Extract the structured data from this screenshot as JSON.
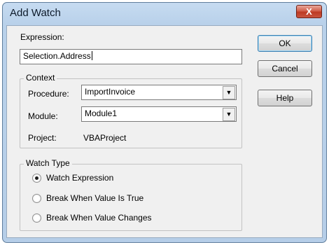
{
  "window": {
    "title": "Add Watch",
    "close_glyph": "X"
  },
  "expression": {
    "label": "Expression:",
    "value": "Selection.Address"
  },
  "context": {
    "legend": "Context",
    "procedure": {
      "label": "Procedure:",
      "value": "ImportInvoice"
    },
    "module": {
      "label": "Module:",
      "value": "Module1"
    },
    "project": {
      "label": "Project:",
      "value": "VBAProject"
    }
  },
  "watch_type": {
    "legend": "Watch Type",
    "options": [
      {
        "label": "Watch Expression",
        "selected": true
      },
      {
        "label": "Break When Value Is True",
        "selected": false
      },
      {
        "label": "Break When Value Changes",
        "selected": false
      }
    ]
  },
  "buttons": {
    "ok": "OK",
    "cancel": "Cancel",
    "help": "Help"
  },
  "icons": {
    "dropdown": "▼"
  }
}
